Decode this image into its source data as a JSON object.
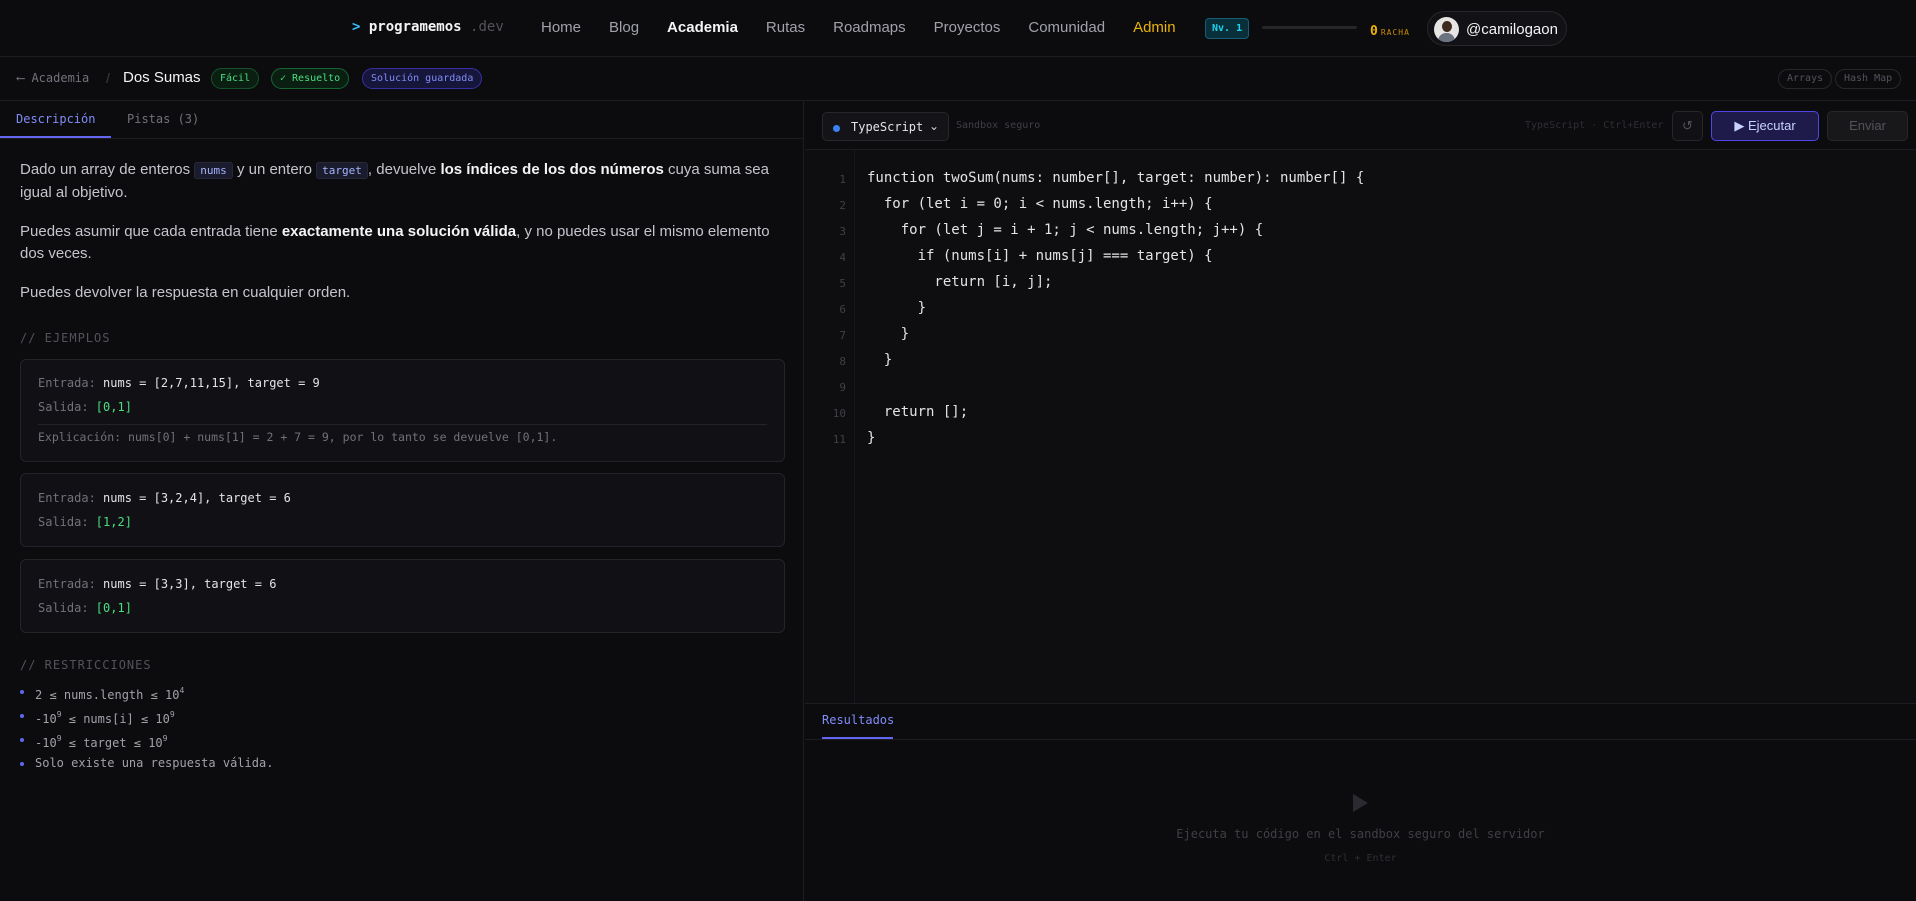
{
  "nav": {
    "logo_prompt": ">",
    "logo_name": "programemos",
    "logo_tld": ".dev",
    "links": [
      "Home",
      "Blog",
      "Academia",
      "Rutas",
      "Roadmaps",
      "Proyectos",
      "Comunidad",
      "Admin"
    ],
    "level": "Nv. 1",
    "xp_fraction": 0,
    "streak_count": "0",
    "streak_label": "RACHA",
    "username": "@camilogaon"
  },
  "subheader": {
    "back": "⟵ Academia",
    "separator": "/",
    "title": "Dos Sumas",
    "badges": [
      "Fácil",
      "✓ Resuelto",
      "Solución guardada"
    ],
    "tags": [
      "Arrays",
      "Hash Map"
    ]
  },
  "left": {
    "tabs": [
      "Descripción",
      "Pistas (3)"
    ],
    "description": {
      "p1_a": "Dado un array de enteros ",
      "p1_code1": "nums",
      "p1_b": " y un entero ",
      "p1_code2": "target",
      "p1_c": ", devuelve ",
      "p1_bold": "los índices de los dos números",
      "p1_d": " cuya suma sea igual al objetivo.",
      "p2_a": "Puedes asumir que cada entrada tiene ",
      "p2_bold": "exactamente una solución válida",
      "p2_b": ", y no puedes usar el mismo elemento dos veces.",
      "p3": "Puedes devolver la respuesta en cualquier orden."
    },
    "examples_heading": "// EJEMPLOS",
    "input_label": "Entrada: ",
    "output_label": "Salida: ",
    "explanation_label": "Explicación: ",
    "examples": [
      {
        "input": "nums = [2,7,11,15], target = 9",
        "output": "[0,1]",
        "explanation": "nums[0] + nums[1] = 2 + 7 = 9, por lo tanto se devuelve [0,1]."
      },
      {
        "input": "nums = [3,2,4], target = 6",
        "output": "[1,2]"
      },
      {
        "input": "nums = [3,3], target = 6",
        "output": "[0,1]"
      }
    ],
    "constraints_heading": "// RESTRICCIONES",
    "constraints": [
      {
        "text": "2 ≤ nums.length ≤ 10",
        "sup": "4"
      },
      {
        "text": "-10",
        "sup": "9",
        "text2": " ≤ nums[i] ≤ 10",
        "sup2": "9"
      },
      {
        "text": "-10",
        "sup": "9",
        "text2": " ≤ target ≤ 10",
        "sup2": "9"
      },
      {
        "text": "Solo existe una respuesta válida."
      }
    ]
  },
  "editor": {
    "language": "TypeScript",
    "sandbox_label": "Sandbox seguro",
    "hint": "TypeScript · Ctrl+Enter",
    "reset_icon": "↺",
    "run_label": "▶ Ejecutar",
    "send_label": "Enviar",
    "lines": [
      "function twoSum(nums: number[], target: number): number[] {",
      "  for (let i = 0; i < nums.length; i++) {",
      "    for (let j = i + 1; j < nums.length; j++) {",
      "      if (nums[i] + nums[j] === target) {",
      "        return [i, j];",
      "      }",
      "    }",
      "  }",
      "",
      "  return [];",
      "}"
    ]
  },
  "results": {
    "tab": "Resultados",
    "empty_title": "Ejecuta tu código en el sandbox seguro del servidor",
    "empty_hint": "Ctrl + Enter"
  }
}
